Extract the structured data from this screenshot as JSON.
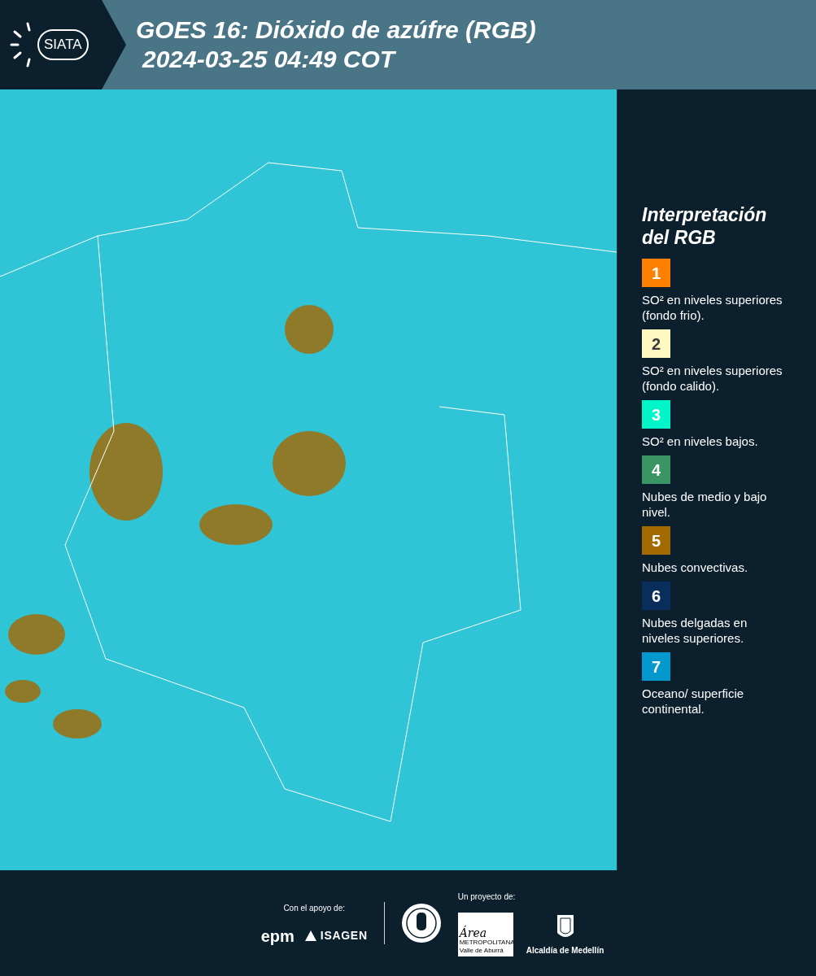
{
  "header": {
    "logo": "SIATA",
    "title": "GOES 16: Dióxido de azúfre (RGB)",
    "timestamp": "2024-03-25 04:49 COT"
  },
  "legend": {
    "title": "Interpretación del RGB",
    "items": [
      {
        "number": "1",
        "color": "#ff7f00",
        "text": "SO² en niveles superiores (fondo frio)."
      },
      {
        "number": "2",
        "color": "#fff8c0",
        "text": "SO² en niveles superiores (fondo calido)."
      },
      {
        "number": "3",
        "color": "#00f5c8",
        "text": "SO² en niveles bajos."
      },
      {
        "number": "4",
        "color": "#3a9464",
        "text": "Nubes de medio y bajo nivel."
      },
      {
        "number": "5",
        "color": "#a26a00",
        "text": "Nubes convectivas."
      },
      {
        "number": "6",
        "color": "#0a2e5c",
        "text": "Nubes delgadas en niveles superiores."
      },
      {
        "number": "7",
        "color": "#0399cf",
        "text": "Oceano/ superficie continental."
      }
    ]
  },
  "footer": {
    "support_label": "Con el apoyo de:",
    "project_label": "Un proyecto de:",
    "epm": "epm",
    "isagen": "ISAGEN",
    "area": "Área",
    "area_sub": "METROPOLITANA",
    "area_sub2": "Valle de Aburrá",
    "alcaldia": "Alcaldía de Medellín"
  }
}
